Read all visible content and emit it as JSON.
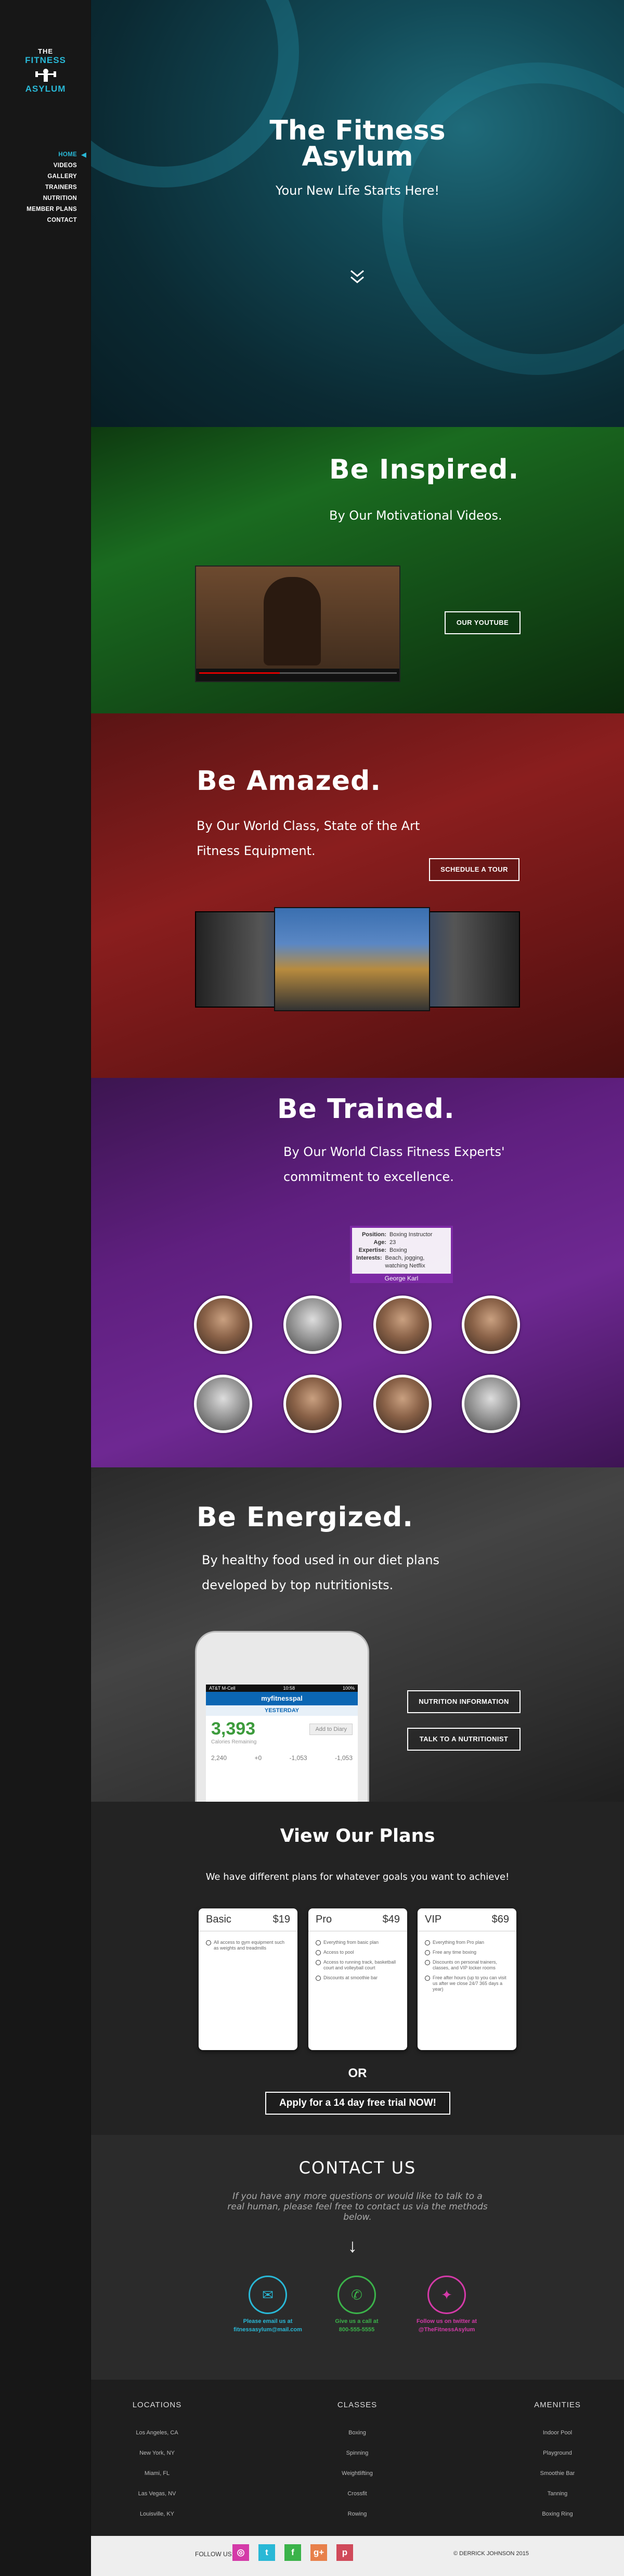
{
  "logo": {
    "line1": "THE",
    "line2": "FITNESS",
    "line3": "ASYLUM"
  },
  "nav": {
    "items": [
      "HOME",
      "VIDEOS",
      "GALLERY",
      "TRAINERS",
      "NUTRITION",
      "MEMBER PLANS",
      "CONTACT"
    ],
    "active": "HOME"
  },
  "hero": {
    "title_line1": "The Fitness",
    "title_line2": "Asylum",
    "subtitle": "Your New Life Starts Here!"
  },
  "inspired": {
    "heading": "Be Inspired.",
    "text": "By Our Motivational Videos.",
    "button": "OUR YOUTUBE"
  },
  "amazed": {
    "heading": "Be Amazed.",
    "text_line1": "By Our World Class, State of the Art",
    "text_line2": "Fitness Equipment.",
    "button": "SCHEDULE A TOUR"
  },
  "trained": {
    "heading": "Be Trained.",
    "text_line1": "By Our World Class Fitness Experts'",
    "text_line2": "commitment to excellence.",
    "tooltip": {
      "position_label": "Position:",
      "position_value": "Boxing Instructor",
      "age_label": "Age:",
      "age_value": "23",
      "expertise_label": "Expertise:",
      "expertise_value": "Boxing",
      "interests_label": "Interests:",
      "interests_value": "Beach, jogging, watching Netflix",
      "name": "George Karl"
    }
  },
  "energized": {
    "heading": "Be Energized.",
    "text_line1": "By healthy food used in our diet plans",
    "text_line2": "developed by top nutritionists.",
    "button1": "NUTRITION INFORMATION",
    "button2": "TALK TO A NUTRITIONIST",
    "phone": {
      "status_left": "AT&T M-Cell",
      "status_time": "10:58",
      "status_right": "100%",
      "app": "myfitnesspal",
      "date": "YESTERDAY",
      "calories": "3,393",
      "calories_label": "Calories Remaining",
      "add_button": "Add to Diary",
      "goal": "2,240",
      "food": "+0",
      "exercise": "-1,053",
      "net": "-1,053"
    }
  },
  "plans": {
    "title": "View Our Plans",
    "subtitle": "We have different plans for whatever goals you want to achieve!",
    "cards": [
      {
        "name": "Basic",
        "price": "$19",
        "features": [
          "All access to gym equipment such as weights and treadmills"
        ]
      },
      {
        "name": "Pro",
        "price": "$49",
        "features": [
          "Everything from basic plan",
          "Access to pool",
          "Access to running track, basketball court and volleyball court",
          "Discounts at smoothie bar"
        ]
      },
      {
        "name": "VIP",
        "price": "$69",
        "features": [
          "Everything from Pro plan",
          "Free any time boxing",
          "Discounts on personal trainers, classes, and VIP locker rooms",
          "Free after hours (up to you can visit us after we close 24/7 365 days a year)"
        ]
      }
    ],
    "or": "OR",
    "trial": "Apply for a 14 day free trial NOW!"
  },
  "contact": {
    "title": "CONTACT US",
    "text": "If you have any more questions or would like to talk to a real human, please feel free to contact us via the methods below.",
    "email_label": "Please email us at",
    "email": "fitnessasylum@mail.com",
    "phone_label": "Give us a call at",
    "phone": "800-555-5555",
    "social_label": "Follow us on twitter at",
    "social": "@TheFitnessAsylum"
  },
  "footer": {
    "locations_title": "LOCATIONS",
    "locations": [
      "Los Angeles, CA",
      "New York, NY",
      "Miami, FL",
      "Las Vegas, NV",
      "Louisville, KY"
    ],
    "classes_title": "CLASSES",
    "classes": [
      "Boxing",
      "Spinning",
      "Weightlifting",
      "Crossfit",
      "Rowing"
    ],
    "amenities_title": "AMENITIES",
    "amenities": [
      "Indoor Pool",
      "Playground",
      "Smoothie Bar",
      "Tanning",
      "Boxing Ring"
    ],
    "follow": "FOLLOW US:",
    "copyright": "© DERRICK JOHNSON 2015",
    "social_icons": [
      "instagram-icon",
      "twitter-icon",
      "facebook-icon",
      "googleplus-icon",
      "pinterest-icon"
    ]
  },
  "colors": {
    "accent": "#29b8d6",
    "green": "#3bb34a",
    "red": "#8a1e1e",
    "purple": "#6e2892",
    "pink": "#d43aa8"
  }
}
